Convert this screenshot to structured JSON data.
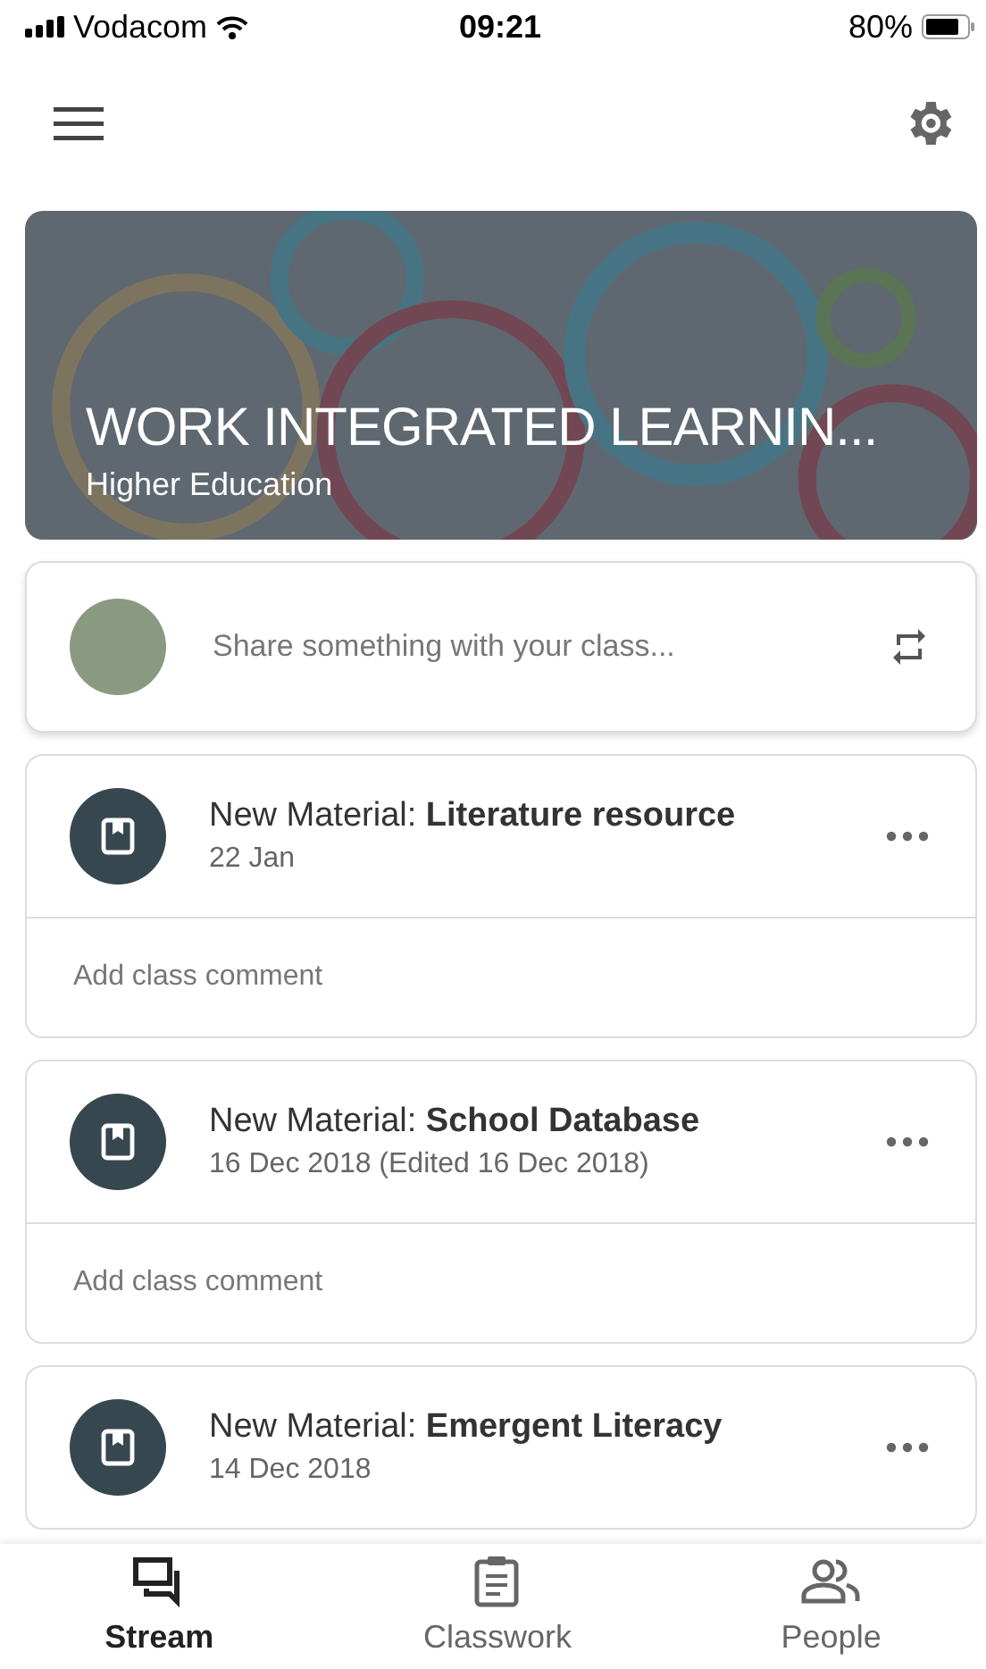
{
  "status_bar": {
    "carrier": "Vodacom",
    "time": "09:21",
    "battery": "80%"
  },
  "banner": {
    "title": "WORK INTEGRATED LEARNIN...",
    "subtitle": "Higher Education"
  },
  "share": {
    "placeholder": "Share something with your class..."
  },
  "posts": [
    {
      "title": "New Material: **Literature resource**",
      "date": "22 Jan",
      "comment_placeholder": "Add class comment"
    },
    {
      "title": "New Material: **School Database**",
      "date": "16 Dec 2018 (Edited 16 Dec 2018)",
      "comment_placeholder": "Add class comment"
    },
    {
      "title": "New Material: **Emergent Literacy**",
      "date": "14 Dec 2018"
    }
  ],
  "tabs": [
    {
      "label": "Stream",
      "kind": "stream",
      "selected": true
    },
    {
      "label": "Classwork",
      "kind": "classwork",
      "selected": false
    },
    {
      "label": "People",
      "kind": "people",
      "selected": false
    }
  ]
}
